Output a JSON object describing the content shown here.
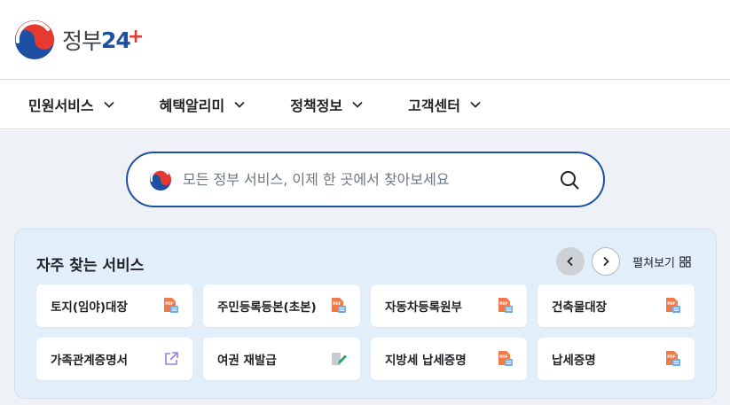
{
  "header": {
    "logo_kr": "정부",
    "logo_num": "24",
    "logo_plus": "+"
  },
  "nav": {
    "items": [
      {
        "label": "민원서비스"
      },
      {
        "label": "혜택알리미"
      },
      {
        "label": "정책정보"
      },
      {
        "label": "고객센터"
      }
    ]
  },
  "search": {
    "placeholder": "모든 정부 서비스, 이제 한 곳에서 찾아보세요",
    "value": ""
  },
  "frequent": {
    "title": "자주 찾는 서비스",
    "expand_label": "펼쳐보기",
    "cards": [
      {
        "label": "토지(임야)대장",
        "icon": "pdf-document-icon"
      },
      {
        "label": "주민등록등본(초본)",
        "icon": "pdf-document-icon"
      },
      {
        "label": "자동차등록원부",
        "icon": "pdf-document-icon"
      },
      {
        "label": "건축물대장",
        "icon": "pdf-document-icon"
      },
      {
        "label": "가족관계증명서",
        "icon": "external-link-icon"
      },
      {
        "label": "여권 재발급",
        "icon": "edit-document-icon"
      },
      {
        "label": "지방세 납세증명",
        "icon": "pdf-document-icon"
      },
      {
        "label": "납세증명",
        "icon": "pdf-document-icon"
      }
    ]
  },
  "colors": {
    "brand_blue": "#1d4fa3",
    "brand_red": "#e7392f",
    "panel_bg": "#e3eefb",
    "page_bg": "#eef2f7"
  }
}
